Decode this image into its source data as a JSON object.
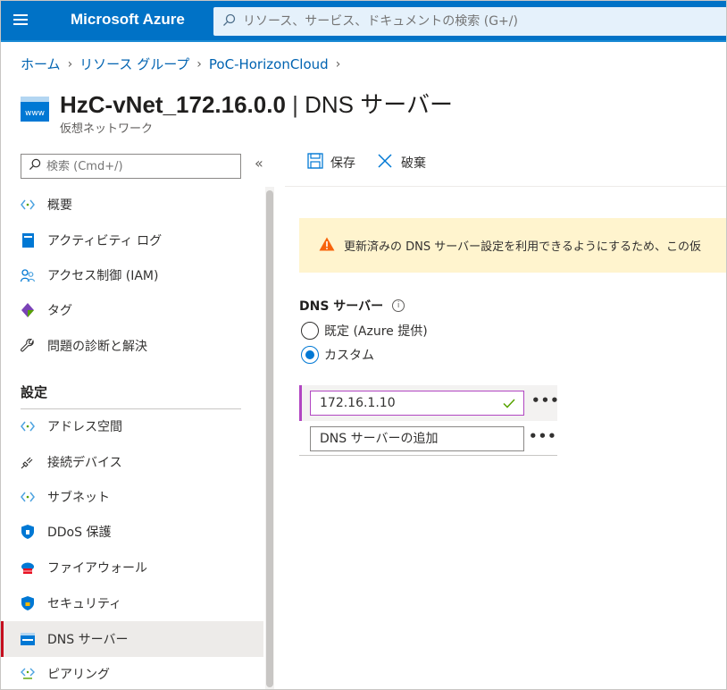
{
  "topbar": {
    "brand": "Microsoft Azure",
    "search_placeholder": "リソース、サービス、ドキュメントの検索 (G+/)"
  },
  "breadcrumb": [
    "ホーム",
    "リソース グループ",
    "PoC-HorizonCloud"
  ],
  "title": {
    "resource": "HzC-vNet_172.16.0.0",
    "separator": " | ",
    "page": "DNS サーバー",
    "subtitle": "仮想ネットワーク"
  },
  "nav": {
    "search_placeholder": "検索 (Cmd+/)",
    "collapse": "«",
    "items_top": [
      {
        "label": "概要",
        "icon": "overview-icon"
      },
      {
        "label": "アクティビティ ログ",
        "icon": "activity-log-icon"
      },
      {
        "label": "アクセス制御 (IAM)",
        "icon": "iam-icon"
      },
      {
        "label": "タグ",
        "icon": "tag-icon"
      },
      {
        "label": "問題の診断と解決",
        "icon": "wrench-icon"
      }
    ],
    "section_settings": "設定",
    "items_settings": [
      {
        "label": "アドレス空間",
        "icon": "address-space-icon"
      },
      {
        "label": "接続デバイス",
        "icon": "plug-icon"
      },
      {
        "label": "サブネット",
        "icon": "subnet-icon"
      },
      {
        "label": "DDoS 保護",
        "icon": "shield-icon"
      },
      {
        "label": "ファイアウォール",
        "icon": "firewall-icon"
      },
      {
        "label": "セキュリティ",
        "icon": "security-shield-icon"
      },
      {
        "label": "DNS サーバー",
        "icon": "dns-icon",
        "selected": true
      },
      {
        "label": "ピアリング",
        "icon": "peering-icon"
      }
    ]
  },
  "commands": {
    "save": "保存",
    "discard": "破棄"
  },
  "warning": {
    "text": "更新済みの DNS サーバー設定を利用できるようにするため、この仮"
  },
  "dns": {
    "label": "DNS サーバー",
    "info": "i",
    "option_default": "既定 (Azure 提供)",
    "option_custom": "カスタム",
    "selected_option": "カスタム",
    "server_value": "172.16.1.10",
    "add_placeholder": "DNS サーバーの追加",
    "more": "•••"
  },
  "colors": {
    "topbar": "#0072c6",
    "accent": "#0078d4",
    "warning_bg": "#fff4ce",
    "active_field": "#b146c2"
  }
}
